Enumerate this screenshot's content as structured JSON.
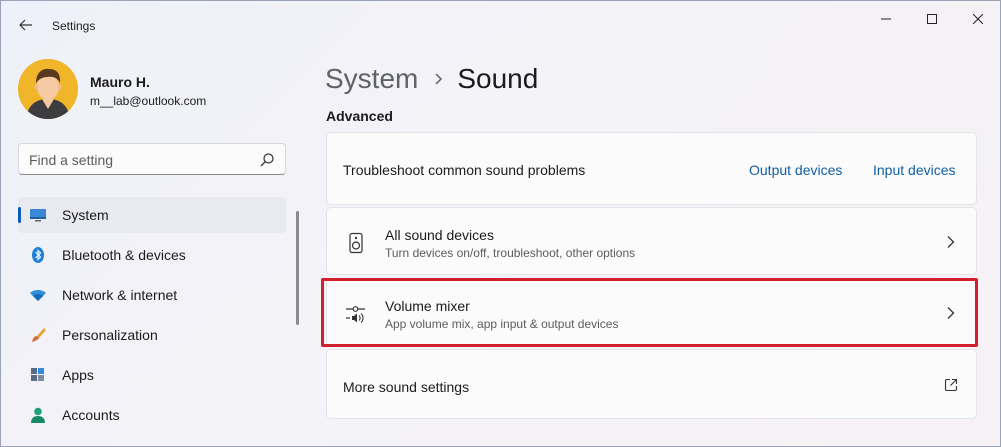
{
  "window": {
    "title": "Settings"
  },
  "profile": {
    "name": "Mauro H.",
    "email": "m__lab@outlook.com"
  },
  "search": {
    "placeholder": "Find a setting"
  },
  "nav": {
    "items": [
      {
        "label": "System",
        "icon": "monitor-icon",
        "active": true
      },
      {
        "label": "Bluetooth & devices",
        "icon": "bluetooth-icon"
      },
      {
        "label": "Network & internet",
        "icon": "wifi-icon"
      },
      {
        "label": "Personalization",
        "icon": "paintbrush-icon"
      },
      {
        "label": "Apps",
        "icon": "apps-icon"
      },
      {
        "label": "Accounts",
        "icon": "person-icon"
      }
    ]
  },
  "breadcrumb": {
    "parent": "System",
    "current": "Sound"
  },
  "section": {
    "title": "Advanced"
  },
  "troubleshoot": {
    "label": "Troubleshoot common sound problems",
    "output_link": "Output devices",
    "input_link": "Input devices"
  },
  "rows": [
    {
      "title": "All sound devices",
      "subtitle": "Turn devices on/off, troubleshoot, other options",
      "icon": "speaker-icon"
    },
    {
      "title": "Volume mixer",
      "subtitle": "App volume mix, app input & output devices",
      "icon": "mixer-icon",
      "highlighted": true
    }
  ],
  "more": {
    "label": "More sound settings",
    "icon": "external-link-icon"
  },
  "colors": {
    "accent": "#0a5fb4",
    "link": "#115ea3",
    "highlight": "#d21f2c"
  }
}
